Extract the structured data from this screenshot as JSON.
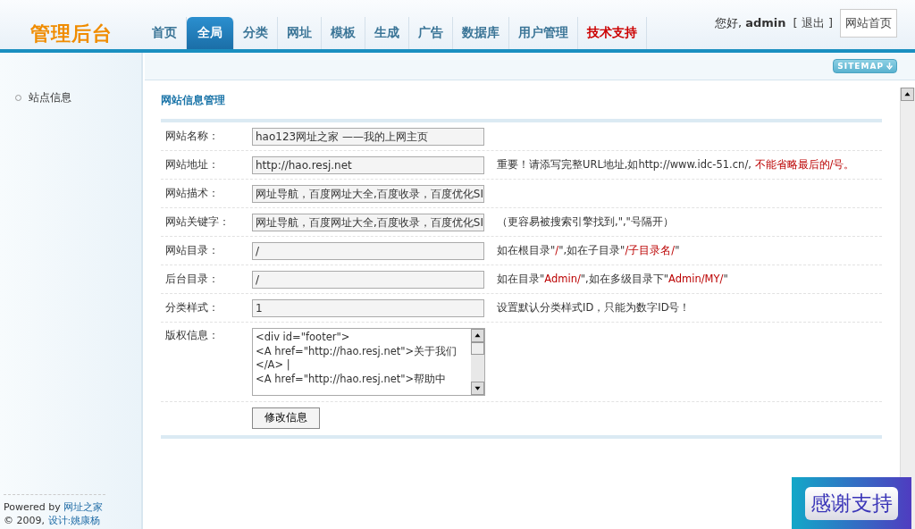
{
  "logo": "管理后台",
  "nav": [
    {
      "label": "首页",
      "selected": false,
      "highlight": false
    },
    {
      "label": "全局",
      "selected": true,
      "highlight": false
    },
    {
      "label": "分类",
      "selected": false,
      "highlight": false
    },
    {
      "label": "网址",
      "selected": false,
      "highlight": false
    },
    {
      "label": "模板",
      "selected": false,
      "highlight": false
    },
    {
      "label": "生成",
      "selected": false,
      "highlight": false
    },
    {
      "label": "广告",
      "selected": false,
      "highlight": false
    },
    {
      "label": "数据库",
      "selected": false,
      "highlight": false
    },
    {
      "label": "用户管理",
      "selected": false,
      "highlight": false
    },
    {
      "label": "技术支持",
      "selected": false,
      "highlight": true
    }
  ],
  "user": {
    "greeting": "您好,",
    "name": "admin",
    "logout": "[ 退出 ]",
    "home_button": "网站首页"
  },
  "sitemap": "SITEMAP",
  "sidebar": {
    "items": [
      {
        "label": "站点信息",
        "selected": false
      }
    ],
    "footer": {
      "powered": "Powered by",
      "powered_link": "网址之家",
      "copyright": "© 2009,",
      "design_link": "设计:姚康杨"
    }
  },
  "form": {
    "title": "网站信息管理",
    "rows": [
      {
        "label": "网站名称：",
        "kind": "input",
        "value": "hao123网址之家 ——我的上网主页",
        "hint": []
      },
      {
        "label": "网站地址：",
        "kind": "input",
        "value": "http://hao.resj.net",
        "hint": [
          {
            "text": "重要！请添写完整URL地址,如http://www.idc-51.cn/, ",
            "red": false
          },
          {
            "text": "不能省略最后的/号。",
            "red": true
          }
        ]
      },
      {
        "label": "网站描术：",
        "kind": "input",
        "value": "网址导航，百度网址大全,百度收录，百度优化SI",
        "hint": []
      },
      {
        "label": "网站关键字：",
        "kind": "input",
        "value": "网址导航，百度网址大全,百度收录，百度优化SI",
        "hint": [
          {
            "text": "（更容易被搜索引擎找到,\",\"号隔开）",
            "red": false
          }
        ]
      },
      {
        "label": "网站目录：",
        "kind": "input",
        "value": "/",
        "hint": [
          {
            "text": "如在根目录\"",
            "red": false
          },
          {
            "text": "/",
            "red": true
          },
          {
            "text": "\",如在子目录\"",
            "red": false
          },
          {
            "text": "/子目录名/",
            "red": true
          },
          {
            "text": "\"",
            "red": false
          }
        ]
      },
      {
        "label": "后台目录：",
        "kind": "input",
        "value": "/",
        "hint": [
          {
            "text": "如在目录\"",
            "red": false
          },
          {
            "text": "Admin/",
            "red": true
          },
          {
            "text": "\",如在多级目录下\"",
            "red": false
          },
          {
            "text": "Admin/MY/",
            "red": true
          },
          {
            "text": "\"",
            "red": false
          }
        ]
      },
      {
        "label": "分类样式：",
        "kind": "input",
        "value": "1",
        "hint": [
          {
            "text": "设置默认分类样式ID，只能为数字ID号！",
            "red": false
          }
        ]
      },
      {
        "label": "版权信息：",
        "kind": "textarea",
        "value": "<div id=\"footer\">\n<A href=\"http://hao.resj.net\">关于我们</A> |\n<A href=\"http://hao.resj.net\">帮助中",
        "hint": []
      }
    ],
    "submit": "修改信息"
  },
  "badge": "感谢支持"
}
